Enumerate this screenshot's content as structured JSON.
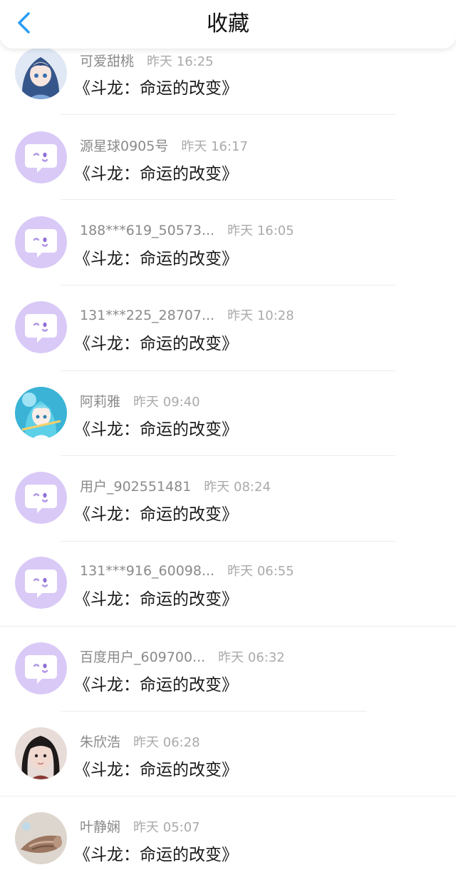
{
  "header": {
    "title": "收藏",
    "back_icon": "chevron-left-icon",
    "accent": "#2a9df4"
  },
  "items": [
    {
      "user": "可爱甜桃",
      "time": "昨天 16:25",
      "book": "《斗龙：命运的改变》",
      "avatar": "anime-girl-blue"
    },
    {
      "user": "源星球0905号",
      "time": "昨天 16:17",
      "book": "《斗龙：命运的改变》",
      "avatar": "default-chat-bubble"
    },
    {
      "user": "188***619_50573...",
      "time": "昨天 16:05",
      "book": "《斗龙：命运的改变》",
      "avatar": "default-chat-bubble"
    },
    {
      "user": "131***225_28707...",
      "time": "昨天 10:28",
      "book": "《斗龙：命运的改变》",
      "avatar": "default-chat-bubble"
    },
    {
      "user": "阿莉雅",
      "time": "昨天 09:40",
      "book": "《斗龙：命运的改变》",
      "avatar": "anime-girl-cyan"
    },
    {
      "user": "用户_902551481",
      "time": "昨天 08:24",
      "book": "《斗龙：命运的改变》",
      "avatar": "default-chat-bubble"
    },
    {
      "user": "131***916_60098...",
      "time": "昨天 06:55",
      "book": "《斗龙：命运的改变》",
      "avatar": "default-chat-bubble"
    },
    {
      "user": "百度用户_609700...",
      "time": "昨天 06:32",
      "book": "《斗龙：命运的改变》",
      "avatar": "default-chat-bubble"
    },
    {
      "user": "朱欣浩",
      "time": "昨天 06:28",
      "book": "《斗龙：命运的改变》",
      "avatar": "photo-girl"
    },
    {
      "user": "叶静娴",
      "time": "昨天 05:07",
      "book": "《斗龙：命运的改变》",
      "avatar": "photo-shell"
    }
  ],
  "colors": {
    "default_avatar": "#d9c9f7",
    "username": "#8a8a8a",
    "timestamp": "#aaaaaa",
    "book_title": "#1a1a1a"
  }
}
